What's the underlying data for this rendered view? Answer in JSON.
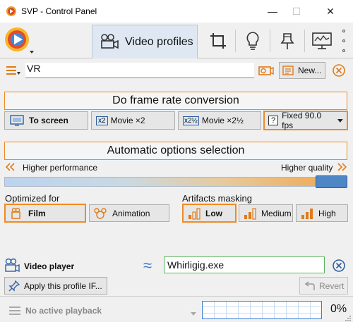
{
  "window": {
    "title": "SVP - Control Panel",
    "controls": {
      "minimize": "—",
      "maximize": "☐",
      "close": "✕"
    }
  },
  "toolbar": {
    "active_tab": "Video profiles",
    "tab_icons": [
      "crop-icon",
      "bulb-icon",
      "pin-icon",
      "monitor-icon"
    ]
  },
  "profile": {
    "name": "VR",
    "new_label": "New..."
  },
  "frame_rate": {
    "header": "Do frame rate conversion",
    "options": [
      {
        "icon_text": "",
        "label": "To screen"
      },
      {
        "icon_text": "x2",
        "label": "Movie ×2"
      },
      {
        "icon_text": "x2½",
        "label": "Movie ×2½"
      },
      {
        "icon_text": "?",
        "label": "Fixed 90.0 fps"
      }
    ]
  },
  "auto_options": {
    "header": "Automatic options selection",
    "left_label": "Higher performance",
    "right_label": "Higher quality",
    "level": 0.92
  },
  "optimized_for": {
    "label": "Optimized for",
    "options": [
      "Film",
      "Animation"
    ],
    "selected": "Film"
  },
  "artifacts": {
    "label": "Artifacts masking",
    "options": [
      "Low",
      "Medium",
      "High"
    ],
    "selected": "Low"
  },
  "player": {
    "label": "Video player",
    "approx_symbol": "≈",
    "value": "Whirligig.exe",
    "apply_label": "Apply this profile IF...",
    "revert_label": "Revert"
  },
  "status": {
    "playback": "No active playback",
    "cpu_percent": "0%"
  },
  "colors": {
    "accent": "#f08a24",
    "slider_thumb": "#4f86c6",
    "graph_border": "#3a7bd5",
    "player_border": "#5db65d"
  }
}
